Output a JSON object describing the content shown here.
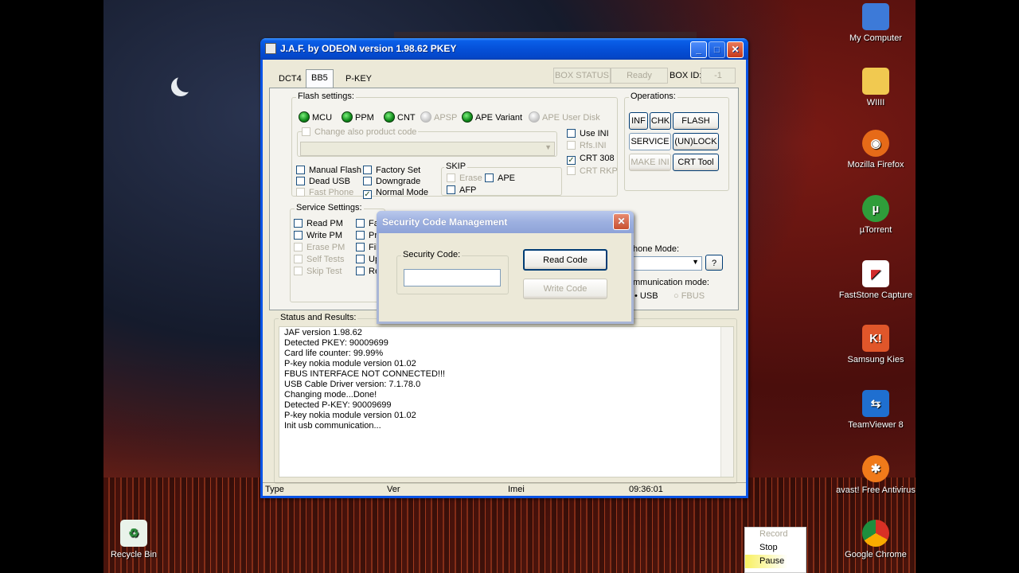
{
  "desktop": {
    "icons": [
      {
        "label": "My Computer",
        "icon": "computer-icon",
        "color": "#3d7ad8",
        "glyph": "▭"
      },
      {
        "label": "WIIII",
        "icon": "folder-icon",
        "color": "#f1c950",
        "glyph": ""
      },
      {
        "label": "Mozilla Firefox",
        "icon": "firefox-icon",
        "color": "#e66a18",
        "glyph": "◉"
      },
      {
        "label": "µTorrent",
        "icon": "utorrent-icon",
        "color": "#2f9d3a",
        "glyph": "µ"
      },
      {
        "label": "FastStone Capture",
        "icon": "faststone-icon",
        "color": "#d02a2a",
        "glyph": "◤"
      },
      {
        "label": "Samsung Kies",
        "icon": "samsung-kies-icon",
        "color": "#e0562a",
        "glyph": "K!"
      },
      {
        "label": "TeamViewer 8",
        "icon": "teamviewer-icon",
        "color": "#1f6fd0",
        "glyph": "⇆"
      },
      {
        "label": "avast! Free Antivirus",
        "icon": "avast-icon",
        "color": "#f07a1a",
        "glyph": "✱"
      },
      {
        "label": "Google Chrome",
        "icon": "chrome-icon",
        "color": "#3a8e3a",
        "glyph": "◎"
      }
    ],
    "recycle_bin": "Recycle Bin"
  },
  "window": {
    "title": "J.A.F. by ODEON version 1.98.62 PKEY",
    "title_buttons": [
      "_",
      "□",
      "✕"
    ],
    "tabs": [
      "DCT4",
      "BB5",
      "P-KEY"
    ],
    "active_tab": "BB5",
    "box_status": {
      "label": "BOX STATUS",
      "value": "Ready",
      "box_id_label": "BOX ID:",
      "box_id_value": "-1"
    },
    "flash_settings": {
      "legend": "Flash settings:",
      "leds": [
        {
          "label": "MCU",
          "enabled": true
        },
        {
          "label": "PPM",
          "enabled": true
        },
        {
          "label": "CNT",
          "enabled": true
        },
        {
          "label": "APSP",
          "enabled": false
        },
        {
          "label": "APE Variant",
          "enabled": true
        },
        {
          "label": "APE User Disk",
          "enabled": false
        }
      ],
      "change_product_code": "Change also product code",
      "right_checks": [
        {
          "label": "Use INI",
          "checked": false,
          "enabled": true
        },
        {
          "label": "Rfs.INI",
          "checked": false,
          "enabled": false
        },
        {
          "label": "CRT 308",
          "checked": true,
          "enabled": true
        },
        {
          "label": "CRT RKP",
          "checked": false,
          "enabled": false
        }
      ],
      "checks": [
        {
          "label": "Manual Flash",
          "checked": false,
          "enabled": true
        },
        {
          "label": "Dead USB",
          "checked": false,
          "enabled": true
        },
        {
          "label": "Fast Phone",
          "checked": false,
          "enabled": false
        },
        {
          "label": "Factory Set",
          "checked": false,
          "enabled": true
        },
        {
          "label": "Downgrade",
          "checked": false,
          "enabled": true
        },
        {
          "label": "Normal Mode",
          "checked": true,
          "enabled": true
        }
      ],
      "skip": {
        "legend": "SKIP",
        "items": [
          {
            "label": "Erase",
            "enabled": false
          },
          {
            "label": "APE",
            "enabled": true
          },
          {
            "label": "AFP",
            "enabled": true
          }
        ]
      }
    },
    "operations": {
      "legend": "Operations:",
      "buttons": [
        {
          "label": "INF",
          "enabled": true
        },
        {
          "label": "CHK",
          "enabled": true
        },
        {
          "label": "FLASH",
          "enabled": true
        },
        {
          "label": "SERVICE",
          "enabled": true
        },
        {
          "label": "(UN)LOCK",
          "enabled": true
        },
        {
          "label": "MAKE INI",
          "enabled": false
        },
        {
          "label": "CRT Tool",
          "enabled": true
        }
      ]
    },
    "service_settings": {
      "legend": "Service Settings:",
      "checks": [
        {
          "label": "Read PM",
          "enabled": true
        },
        {
          "label": "Write PM",
          "enabled": true
        },
        {
          "label": "Erase PM",
          "enabled": false
        },
        {
          "label": "Self Tests",
          "enabled": false
        },
        {
          "label": "Skip Test",
          "enabled": false
        }
      ],
      "second_col": [
        "Fa",
        "Pr",
        "Fil",
        "Up",
        "Re"
      ]
    },
    "phone_mode": {
      "label": "hone Mode:",
      "help": "?"
    },
    "comm_mode": {
      "label": "mmunication mode:",
      "options": [
        "USB",
        "FBUS"
      ],
      "selected": "USB"
    },
    "status": {
      "legend": "Status and Results:",
      "lines": [
        "JAF version 1.98.62",
        "Detected PKEY: 90009699",
        "Card life counter: 99.99%",
        "P-key nokia module version 01.02",
        "FBUS INTERFACE NOT CONNECTED!!!",
        "USB Cable Driver version: 7.1.78.0",
        "Changing mode...Done!",
        "Detected P-KEY: 90009699",
        "P-key nokia module version 01.02",
        "Init usb communication..."
      ]
    },
    "statusbar": {
      "type": "Type",
      "ver": "Ver",
      "imei": "Imei",
      "time": "09:36:01"
    }
  },
  "dialog": {
    "title": "Security Code Management",
    "close": "✕",
    "group_label": "Security Code:",
    "code_value": "",
    "read_button": "Read Code",
    "write_button": "Write Code"
  },
  "recorder": {
    "items": [
      "Record",
      "Stop",
      "Pause"
    ]
  }
}
